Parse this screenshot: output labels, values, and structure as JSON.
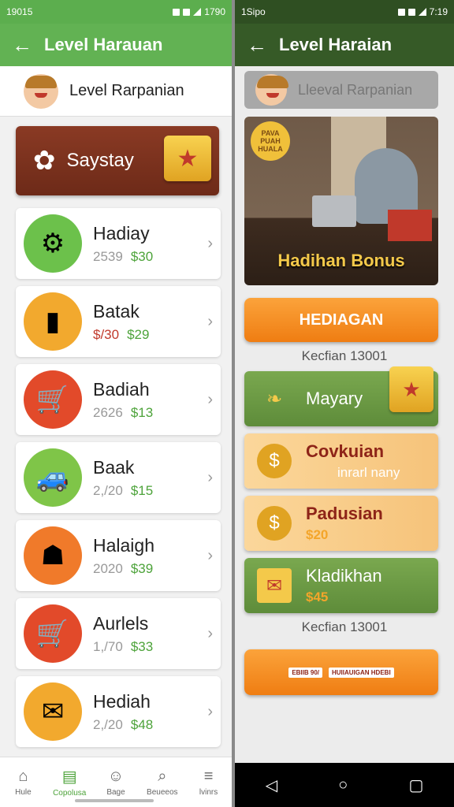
{
  "left": {
    "status": {
      "time": "19015",
      "right": "1790"
    },
    "appbar": {
      "back": "←",
      "title": "Level Harauan"
    },
    "profile": {
      "name": "Level Rarpanian"
    },
    "hero": {
      "title": "Saystay",
      "icon": "gear-icon"
    },
    "items": [
      {
        "title": "Hadiay",
        "n1": "2539",
        "n2": "$30",
        "bg": "#6cc14b",
        "icon": "⚙"
      },
      {
        "title": "Batak",
        "n1": "$/30",
        "n2": "$29",
        "bg": "#f2a92e",
        "icon": "▮",
        "n1color": "#c0392b"
      },
      {
        "title": "Badiah",
        "n1": "2626",
        "n2": "$13",
        "bg": "#e24a2a",
        "icon": "🛒"
      },
      {
        "title": "Baak",
        "n1": "2,/20",
        "n2": "$15",
        "bg": "#7fc548",
        "icon": "🚙"
      },
      {
        "title": "Halaigh",
        "n1": "2020",
        "n2": "$39",
        "bg": "#f07a2a",
        "icon": "☗"
      },
      {
        "title": "Aurlels",
        "n1": "1,/70",
        "n2": "$33",
        "bg": "#e24a2a",
        "icon": "🛒"
      },
      {
        "title": "Hediah",
        "n1": "2,/20",
        "n2": "$48",
        "bg": "#f2a92e",
        "icon": "✉"
      }
    ],
    "nav": [
      {
        "label": "Hule",
        "icon": "⌂"
      },
      {
        "label": "Copolusa",
        "icon": "▤",
        "active": true
      },
      {
        "label": "Bage",
        "icon": "☺"
      },
      {
        "label": "Beueeos",
        "icon": "⌕"
      },
      {
        "label": "lvinrs",
        "icon": "≡"
      }
    ]
  },
  "right": {
    "status": {
      "time": "1Sipo",
      "right": "7:19"
    },
    "appbar": {
      "back": "←",
      "title": "Level Haraian"
    },
    "profile": {
      "name": "Lleeval Rarpanian"
    },
    "photo": {
      "badge": "PAVA PUAH HUALA",
      "caption": "Hadihan Bonus"
    },
    "button1": "HEDIAGAN",
    "sub1": "Kecfian 13001",
    "cards": [
      {
        "title": "Mayary",
        "sub": ""
      },
      {
        "title": "Covkuian",
        "sub": "inrarl nany"
      },
      {
        "title": "Padusian",
        "sub": "$20"
      },
      {
        "title": "Kladikhan",
        "sub": "$45"
      }
    ],
    "sub2": "Kecfian 13001",
    "bottom_tags": {
      "tag1": "EBIIB 90/",
      "tag2": "HUIIAUIGAN HDEBI"
    },
    "sysnav": {
      "back": "◁",
      "home": "○",
      "recent": "▢"
    }
  }
}
